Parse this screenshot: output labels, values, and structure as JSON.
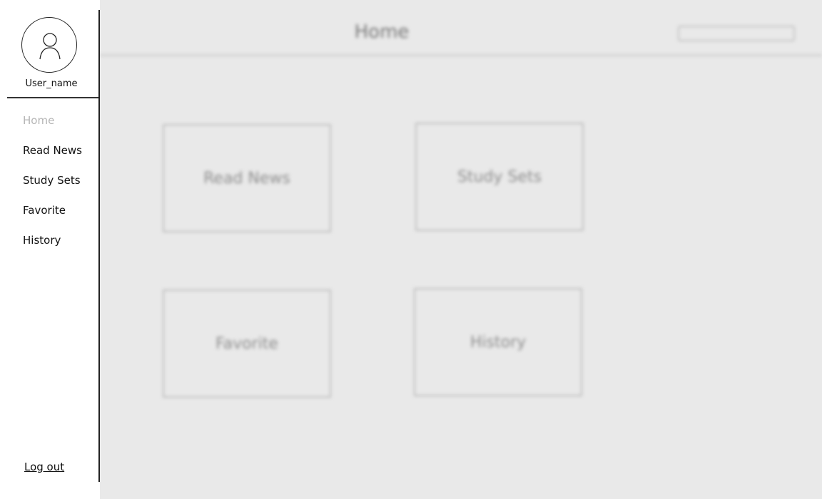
{
  "user": {
    "name": "User_name"
  },
  "sidebar": {
    "items": [
      {
        "label": "Home"
      },
      {
        "label": "Read News"
      },
      {
        "label": "Study Sets"
      },
      {
        "label": "Favorite"
      },
      {
        "label": "History"
      }
    ],
    "logout_label": "Log out"
  },
  "header": {
    "title": "Home"
  },
  "cards": [
    {
      "label": "Read News"
    },
    {
      "label": "Study Sets"
    },
    {
      "label": "Favorite"
    },
    {
      "label": "History"
    }
  ],
  "colors": {
    "main_background": "#e9e9e9",
    "active_nav": "#b5b5b5",
    "ink": "#111111"
  }
}
